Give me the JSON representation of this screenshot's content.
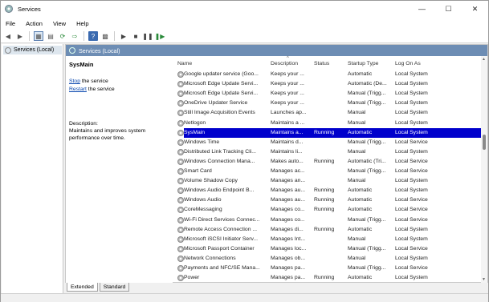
{
  "window": {
    "title": "Services",
    "minimize": "—",
    "maximize": "☐",
    "close": "✕"
  },
  "menu": [
    "File",
    "Action",
    "View",
    "Help"
  ],
  "tree": {
    "item": "Services (Local)"
  },
  "header": {
    "title": "Services (Local)"
  },
  "extended": {
    "service_name": "SysMain",
    "stop_link": "Stop",
    "stop_suffix": " the service",
    "restart_link": "Restart",
    "restart_suffix": " the service",
    "description_label": "Description:",
    "description_text": "Maintains and improves system performance over time."
  },
  "columns": {
    "name": "Name",
    "description": "Description",
    "status": "Status",
    "startup": "Startup Type",
    "logon": "Log On As"
  },
  "rows": [
    {
      "name": "Google updater service (Goo...",
      "description": "Keeps your ...",
      "status": "",
      "startup": "Automatic",
      "logon": "Local System"
    },
    {
      "name": "Microsoft Edge Update Servi...",
      "description": "Keeps your ...",
      "status": "",
      "startup": "Automatic (De...",
      "logon": "Local System"
    },
    {
      "name": "Microsoft Edge Update Servi...",
      "description": "Keeps your ...",
      "status": "",
      "startup": "Manual (Trigg...",
      "logon": "Local System"
    },
    {
      "name": "OneDrive Updater Service",
      "description": "Keeps your ...",
      "status": "",
      "startup": "Manual (Trigg...",
      "logon": "Local System"
    },
    {
      "name": "Still Image Acquisition Events",
      "description": "Launches ap...",
      "status": "",
      "startup": "Manual",
      "logon": "Local System"
    },
    {
      "name": "Netlogon",
      "description": "Maintains a ...",
      "status": "",
      "startup": "Manual",
      "logon": "Local System"
    },
    {
      "name": "SysMain",
      "description": "Maintains a...",
      "status": "Running",
      "startup": "Automatic",
      "logon": "Local System",
      "selected": true
    },
    {
      "name": "Windows Time",
      "description": "Maintains d...",
      "status": "",
      "startup": "Manual (Trigg...",
      "logon": "Local Service"
    },
    {
      "name": "Distributed Link Tracking Cli...",
      "description": "Maintains li...",
      "status": "",
      "startup": "Manual",
      "logon": "Local System"
    },
    {
      "name": "Windows Connection Mana...",
      "description": "Makes auto...",
      "status": "Running",
      "startup": "Automatic (Tri...",
      "logon": "Local Service"
    },
    {
      "name": "Smart Card",
      "description": "Manages ac...",
      "status": "",
      "startup": "Manual (Trigg...",
      "logon": "Local Service"
    },
    {
      "name": "Volume Shadow Copy",
      "description": "Manages an...",
      "status": "",
      "startup": "Manual",
      "logon": "Local System"
    },
    {
      "name": "Windows Audio Endpoint B...",
      "description": "Manages au...",
      "status": "Running",
      "startup": "Automatic",
      "logon": "Local System"
    },
    {
      "name": "Windows Audio",
      "description": "Manages au...",
      "status": "Running",
      "startup": "Automatic",
      "logon": "Local Service"
    },
    {
      "name": "CoreMessaging",
      "description": "Manages co...",
      "status": "Running",
      "startup": "Automatic",
      "logon": "Local Service"
    },
    {
      "name": "Wi-Fi Direct Services Connec...",
      "description": "Manages co...",
      "status": "",
      "startup": "Manual (Trigg...",
      "logon": "Local Service"
    },
    {
      "name": "Remote Access Connection ...",
      "description": "Manages di...",
      "status": "Running",
      "startup": "Automatic",
      "logon": "Local System"
    },
    {
      "name": "Microsoft iSCSI Initiator Serv...",
      "description": "Manages Int...",
      "status": "",
      "startup": "Manual",
      "logon": "Local System"
    },
    {
      "name": "Microsoft Passport Container",
      "description": "Manages loc...",
      "status": "",
      "startup": "Manual (Trigg...",
      "logon": "Local Service"
    },
    {
      "name": "Network Connections",
      "description": "Manages ob...",
      "status": "",
      "startup": "Manual",
      "logon": "Local System"
    },
    {
      "name": "Payments and NFC/SE Mana...",
      "description": "Manages pa...",
      "status": "",
      "startup": "Manual (Trigg...",
      "logon": "Local Service"
    },
    {
      "name": "Power",
      "description": "Manages pa...",
      "status": "Running",
      "startup": "Automatic",
      "logon": "Local System"
    }
  ],
  "tabs": [
    "Extended",
    "Standard"
  ]
}
